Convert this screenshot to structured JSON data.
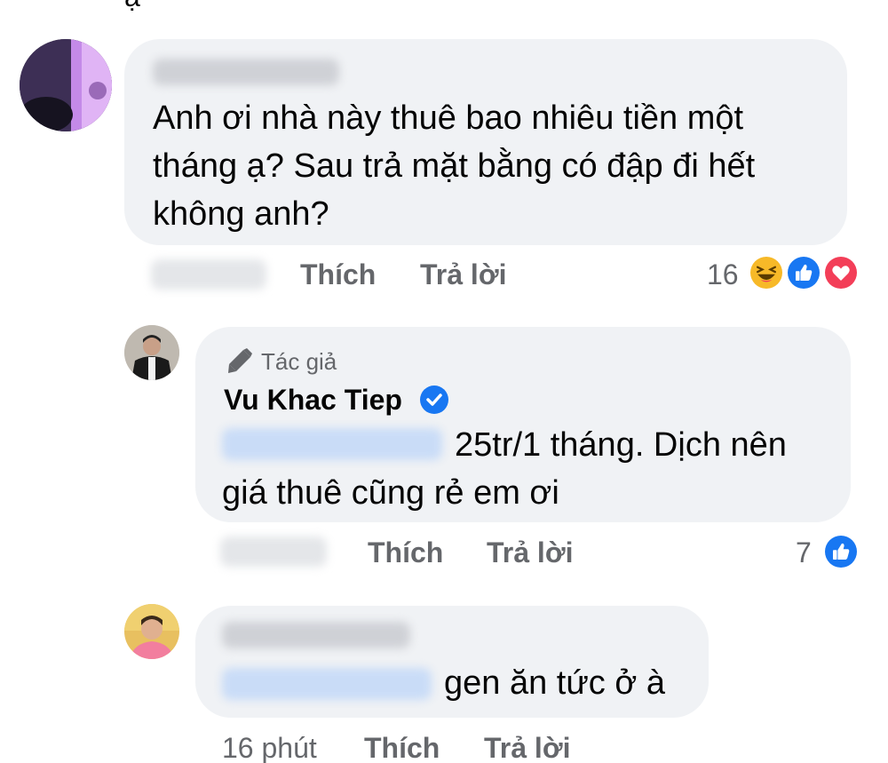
{
  "comments": [
    {
      "text": "Anh ơi nhà này thuê bao nhiêu tiền một tháng ạ? Sau trả mặt bằng có đập đi hết không anh?",
      "actions": {
        "like": "Thích",
        "reply": "Trả lời"
      },
      "reaction_count": "16",
      "reactions": [
        "haha-icon",
        "like-icon",
        "love-icon"
      ]
    },
    {
      "author_badge": "Tác giả",
      "author_name": "Vu Khac Tiep",
      "text": "25tr/1 tháng. Dịch nên giá thuê cũng rẻ em ơi",
      "actions": {
        "like": "Thích",
        "reply": "Trả lời"
      },
      "reaction_count": "7",
      "reactions": [
        "like-icon"
      ]
    },
    {
      "text": "gen ăn tức ở à",
      "timestamp": "16 phút",
      "actions": {
        "like": "Thích",
        "reply": "Trả lời"
      }
    }
  ],
  "colors": {
    "bubble": "#f0f2f5",
    "meta_text": "#65676b",
    "like_blue": "#1877f2",
    "love_red": "#f33e58",
    "haha_yellow": "#f7b928"
  }
}
